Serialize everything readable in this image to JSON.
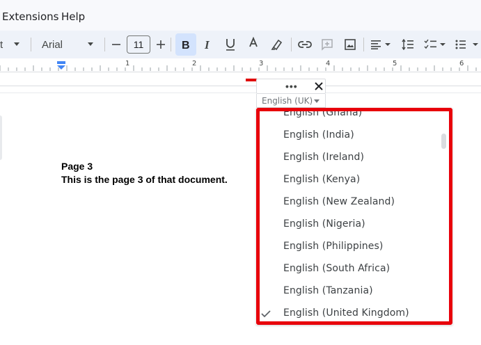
{
  "menubar": {
    "items": [
      {
        "label": "Extensions"
      },
      {
        "label": "Help"
      }
    ]
  },
  "toolbar": {
    "style_value": "t",
    "font_value": "Arial",
    "font_size": "11",
    "icons": [
      "caret-down-icon",
      "minus-icon",
      "plus-icon",
      "bold-icon",
      "italic-icon",
      "underline-icon",
      "text-color-icon",
      "highlighter-icon",
      "link-icon",
      "add-comment-icon",
      "image-icon",
      "align-icon",
      "line-spacing-icon",
      "checklist-icon",
      "bulleted-list-icon"
    ],
    "text_color": "#e00000",
    "active_bg": "#d3e3fd"
  },
  "ruler": {
    "numbers": [
      "1",
      "2",
      "3",
      "4",
      "5",
      "6"
    ]
  },
  "document": {
    "heading": "Page 3",
    "body": "This is the page 3 of that document."
  },
  "language_widget": {
    "more_label": "•••",
    "selected_language": "English (UK)"
  },
  "language_dropdown": {
    "options": [
      {
        "label": "English (Ghana)",
        "checked": false
      },
      {
        "label": "English (India)",
        "checked": false
      },
      {
        "label": "English (Ireland)",
        "checked": false
      },
      {
        "label": "English (Kenya)",
        "checked": false
      },
      {
        "label": "English (New Zealand)",
        "checked": false
      },
      {
        "label": "English (Nigeria)",
        "checked": false
      },
      {
        "label": "English (Philippines)",
        "checked": false
      },
      {
        "label": "English (South Africa)",
        "checked": false
      },
      {
        "label": "English (Tanzania)",
        "checked": false
      },
      {
        "label": "English (United Kingdom)",
        "checked": true
      }
    ],
    "highlight_color": "#e8000b"
  }
}
